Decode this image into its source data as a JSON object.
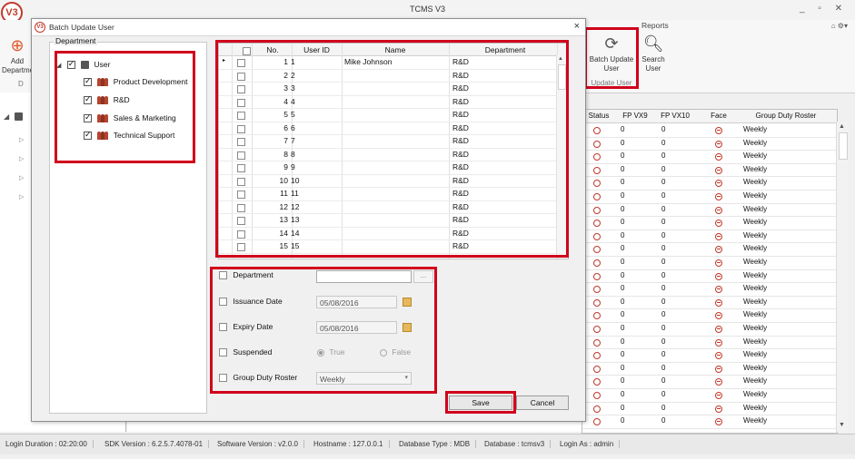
{
  "app": {
    "title": "TCMS V3",
    "logo": "V3",
    "window_controls": "_ ▫ ✕"
  },
  "ribbon": {
    "add_department_label": "Add Department",
    "add_group_caption": "D",
    "reports_label": "Reports",
    "batch_update_label": "Batch Update User",
    "search_user_label": "Search User",
    "update_user_group": "Update User",
    "right_icons": "⌂ ⚙▾"
  },
  "main_grid": {
    "columns": [
      "Status",
      "FP VX9",
      "FP VX10",
      "Face",
      "Group Duty Roster"
    ],
    "rows_fp9": "0",
    "rows_fp10": "0",
    "roster": "Weekly",
    "row_count": 23
  },
  "status_bar": {
    "login_duration": "Login Duration : 02:20:00",
    "sdk_version": "SDK Version : 6.2.5.7.4078-01",
    "software_version": "Software Version : v2.0.0",
    "hostname": "Hostname : 127.0.0.1",
    "database_type": "Database Type : MDB",
    "database": "Database : tcmsv3",
    "login_as": "Login As : admin"
  },
  "dialog": {
    "title": "Batch Update User",
    "close": "×",
    "department_group_label": "Department",
    "tree": {
      "root": "User",
      "children": [
        "Product Development",
        "R&D",
        "Sales & Marketing",
        "Technical Support"
      ]
    },
    "grid": {
      "columns": [
        "No.",
        "User ID",
        "Name",
        "Department"
      ],
      "rows": [
        {
          "no": "1",
          "id": "1",
          "name": "Mike Johnson",
          "dept": "R&D"
        },
        {
          "no": "2",
          "id": "2",
          "name": "",
          "dept": "R&D"
        },
        {
          "no": "3",
          "id": "3",
          "name": "",
          "dept": "R&D"
        },
        {
          "no": "4",
          "id": "4",
          "name": "",
          "dept": "R&D"
        },
        {
          "no": "5",
          "id": "5",
          "name": "",
          "dept": "R&D"
        },
        {
          "no": "6",
          "id": "6",
          "name": "",
          "dept": "R&D"
        },
        {
          "no": "7",
          "id": "7",
          "name": "",
          "dept": "R&D"
        },
        {
          "no": "8",
          "id": "8",
          "name": "",
          "dept": "R&D"
        },
        {
          "no": "9",
          "id": "9",
          "name": "",
          "dept": "R&D"
        },
        {
          "no": "10",
          "id": "10",
          "name": "",
          "dept": "R&D"
        },
        {
          "no": "11",
          "id": "11",
          "name": "",
          "dept": "R&D"
        },
        {
          "no": "12",
          "id": "12",
          "name": "",
          "dept": "R&D"
        },
        {
          "no": "13",
          "id": "13",
          "name": "",
          "dept": "R&D"
        },
        {
          "no": "14",
          "id": "14",
          "name": "",
          "dept": "R&D"
        },
        {
          "no": "15",
          "id": "15",
          "name": "",
          "dept": "R&D"
        }
      ]
    },
    "form": {
      "department_label": "Department",
      "department_value": "",
      "issuance_label": "Issuance Date",
      "issuance_value": "05/08/2016",
      "expiry_label": "Expiry Date",
      "expiry_value": "05/08/2016",
      "suspended_label": "Suspended",
      "true_label": "True",
      "false_label": "False",
      "roster_label": "Group Duty Roster",
      "roster_value": "Weekly"
    },
    "save_label": "Save",
    "cancel_label": "Cancel"
  },
  "colors": {
    "highlight": "#d0021b",
    "status_icon": "#c0392b"
  }
}
